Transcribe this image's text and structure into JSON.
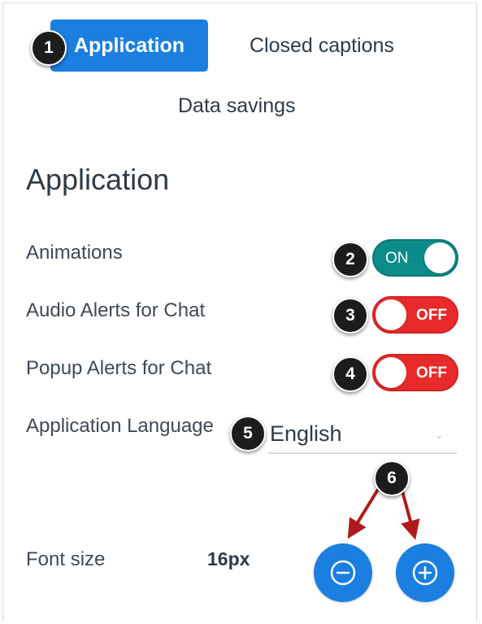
{
  "tabs": {
    "application": "Application",
    "closed_captions": "Closed captions",
    "data_savings": "Data savings"
  },
  "section": {
    "title": "Application"
  },
  "settings": {
    "animations": {
      "label": "Animations",
      "state": "ON"
    },
    "audio_alerts": {
      "label": "Audio Alerts for Chat",
      "state": "OFF"
    },
    "popup_alerts": {
      "label": "Popup Alerts for Chat",
      "state": "OFF"
    },
    "language": {
      "label": "Application Language",
      "value": "English"
    },
    "font_size": {
      "label": "Font size",
      "value": "16px"
    }
  },
  "callouts": [
    "1",
    "2",
    "3",
    "4",
    "5",
    "6"
  ],
  "icons": {
    "decrease": "minus-circle-icon",
    "increase": "plus-circle-icon",
    "dropdown": "chevron-down-icon"
  },
  "colors": {
    "accent": "#1a7fe0",
    "toggle_on": "#0b8c8a",
    "toggle_off": "#e82a2a",
    "callout": "#1c1c1c",
    "arrow": "#b01a1a"
  }
}
